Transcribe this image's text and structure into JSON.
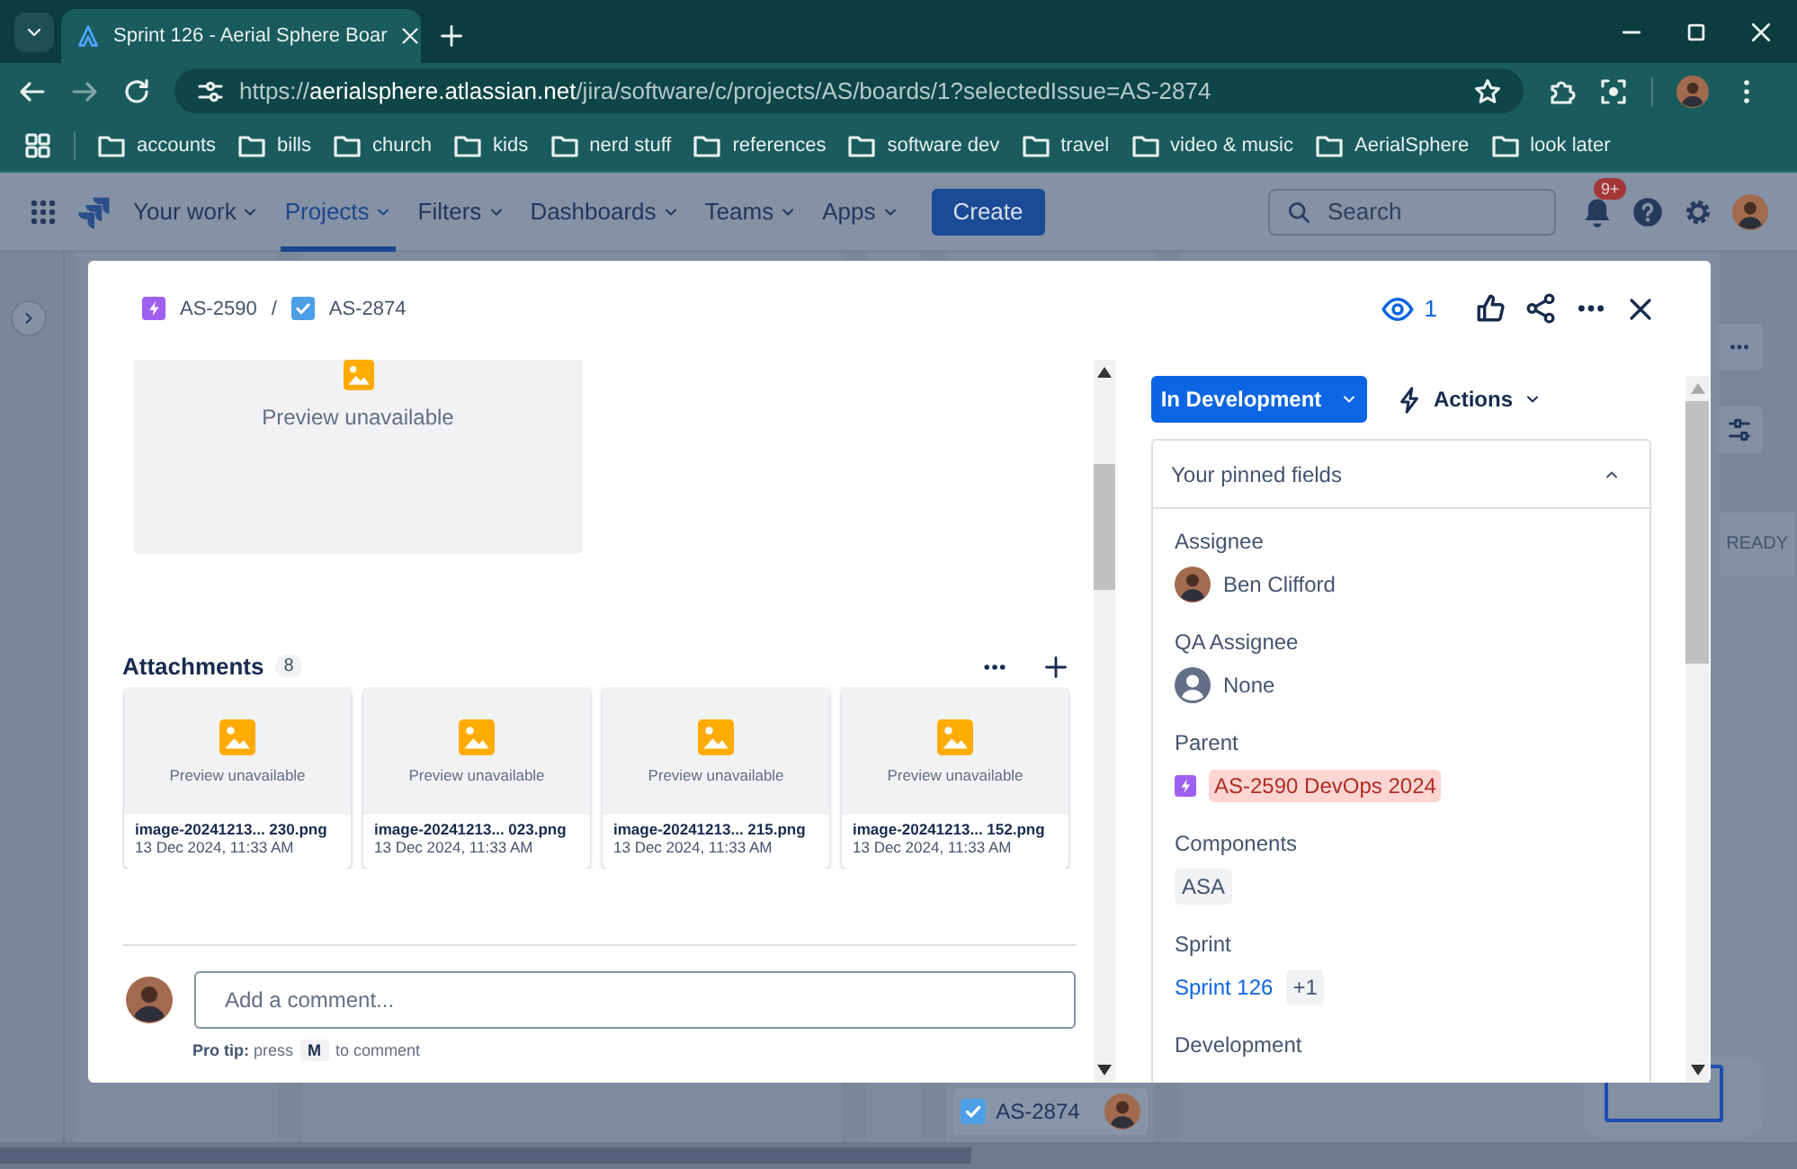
{
  "browser": {
    "tabs": [
      {
        "title": "Sprint 126 - Aerial Sphere Boar",
        "selected": true
      }
    ],
    "url": {
      "scheme": "https://",
      "host": "aerialsphere.atlassian.net",
      "path": "/jira/software/c/projects/AS/boards/1?selectedIssue=AS-2874"
    },
    "bookmarks": [
      "accounts",
      "bills",
      "church",
      "kids",
      "nerd stuff",
      "references",
      "software dev",
      "travel",
      "video & music",
      "AerialSphere",
      "look later"
    ]
  },
  "nav": {
    "items": [
      {
        "label": "Your work",
        "selected": false
      },
      {
        "label": "Projects",
        "selected": true
      },
      {
        "label": "Filters",
        "selected": false
      },
      {
        "label": "Dashboards",
        "selected": false
      },
      {
        "label": "Teams",
        "selected": false
      },
      {
        "label": "Apps",
        "selected": false
      }
    ],
    "create": "Create",
    "search": {
      "placeholder": "Search"
    },
    "notifications": "9+"
  },
  "board": {
    "column_header": "READY",
    "card": {
      "key": "AS-2874"
    }
  },
  "issue": {
    "breadcrumbs": [
      {
        "key": "AS-2590",
        "kind": "epic"
      },
      {
        "key": "AS-2874",
        "kind": "task"
      }
    ],
    "separator": "/",
    "watchers": "1",
    "preview": "Preview unavailable",
    "attachments": {
      "title": "Attachments",
      "count": "8",
      "items": [
        {
          "name": "image-20241213... 230.png",
          "date": "13 Dec 2024, 11:33 AM",
          "preview": "Preview unavailable"
        },
        {
          "name": "image-20241213... 023.png",
          "date": "13 Dec 2024, 11:33 AM",
          "preview": "Preview unavailable"
        },
        {
          "name": "image-20241213... 215.png",
          "date": "13 Dec 2024, 11:33 AM",
          "preview": "Preview unavailable"
        },
        {
          "name": "image-20241213... 152.png",
          "date": "13 Dec 2024, 11:33 AM",
          "preview": "Preview unavailable"
        }
      ]
    },
    "comment": {
      "placeholder": "Add a comment...",
      "tip": "**Pro tip:** press",
      "key": "M",
      "tip_end": "to comment"
    },
    "status": "In Development",
    "actions": "Actions",
    "pinned": {
      "title": "Your pinned fields",
      "expanded": true,
      "fields": [
        {
          "label": "Assignee",
          "kind": "user",
          "value": "Ben Clifford"
        },
        {
          "label": "QA Assignee",
          "kind": "empty-user",
          "value": "None"
        },
        {
          "label": "Parent",
          "kind": "parent",
          "value": "AS-2590 DevOps 2024"
        },
        {
          "label": "Components",
          "kind": "tags",
          "values": [
            "ASA"
          ]
        },
        {
          "label": "Sprint",
          "kind": "sprint",
          "value": "Sprint 126",
          "extra": "+1"
        },
        {
          "label": "Development",
          "kind": "heading"
        }
      ]
    }
  }
}
